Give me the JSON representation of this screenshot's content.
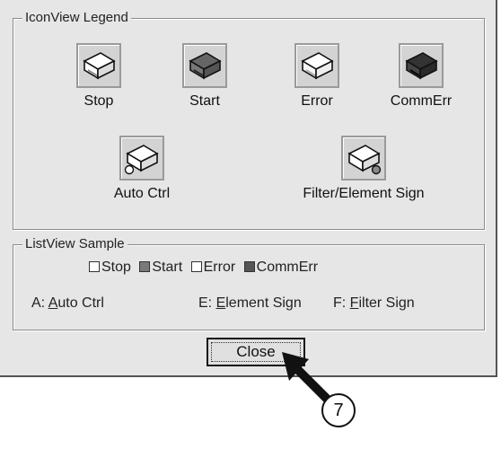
{
  "iconview": {
    "title": "IconView Legend",
    "items": [
      {
        "label": "Stop",
        "state": "stop",
        "badge": ""
      },
      {
        "label": "Start",
        "state": "start",
        "badge": ""
      },
      {
        "label": "Error",
        "state": "error",
        "badge": ""
      },
      {
        "label": "CommErr",
        "state": "commerr",
        "badge": ""
      },
      {
        "label": "Auto Ctrl",
        "state": "stop",
        "badge": "auto"
      },
      {
        "label": "Filter/Element Sign",
        "state": "stop",
        "badge": "filter"
      }
    ]
  },
  "listview": {
    "title": "ListView Sample",
    "states": [
      {
        "label": "Stop",
        "color": "#ffffff"
      },
      {
        "label": "Start",
        "color": "#7a7a7a"
      },
      {
        "label": "Error",
        "color": "#ffffff"
      },
      {
        "label": "CommErr",
        "color": "#555555"
      }
    ],
    "signs": [
      {
        "prefix": "A: ",
        "key": "A",
        "rest": "uto Ctrl"
      },
      {
        "prefix": "E: ",
        "key": "E",
        "rest": "lement Sign"
      },
      {
        "prefix": "F: ",
        "key": "F",
        "rest": "ilter Sign"
      }
    ]
  },
  "close_button": {
    "label": "Close"
  },
  "callout": {
    "number": "7"
  },
  "icons": {
    "unit": "air-conditioner-unit-icon",
    "pointer": "arrow-pointer-icon"
  }
}
